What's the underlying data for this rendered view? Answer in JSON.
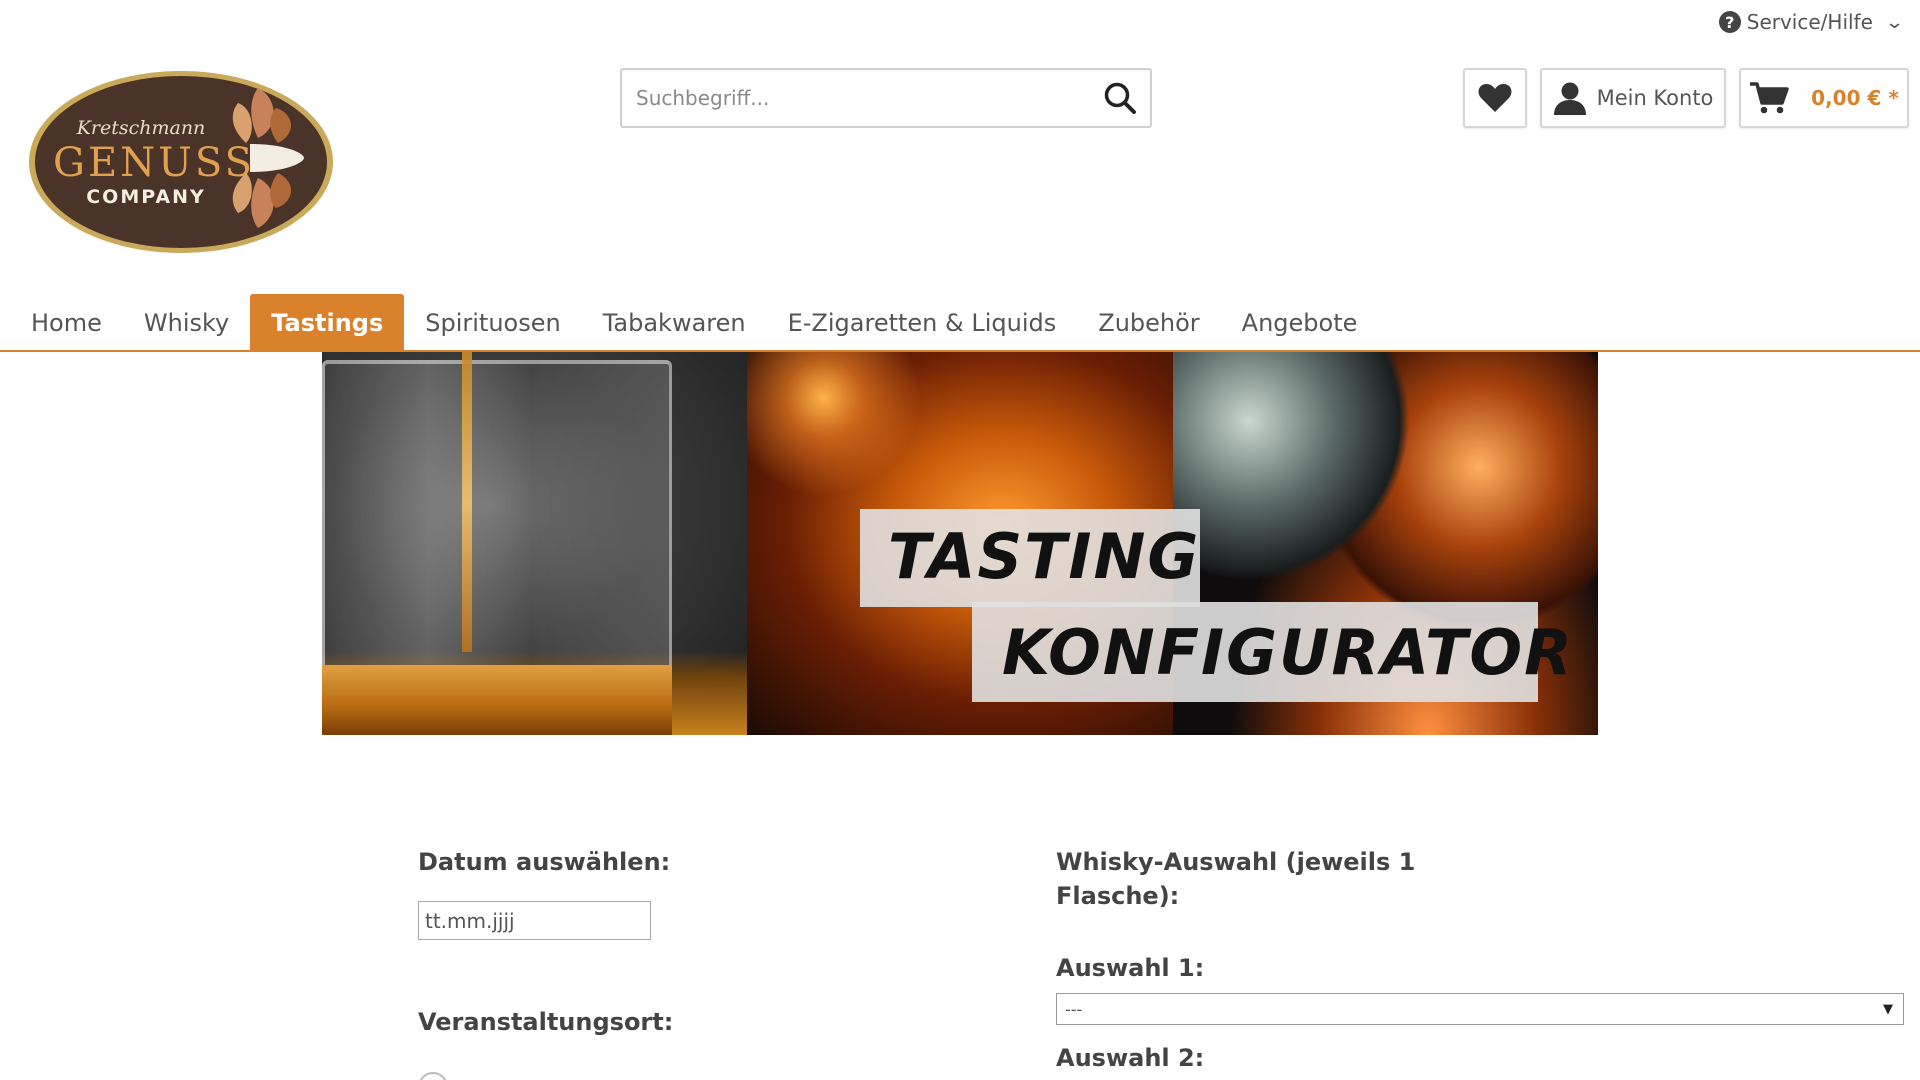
{
  "header": {
    "service_label": "Service/Hilfe",
    "search_placeholder": "Suchbegriff...",
    "account_label": "Mein Konto",
    "cart_amount": "0,00 € *",
    "logo": {
      "script": "Kretschmann",
      "word": "GENUSS",
      "sub": "COMPANY"
    }
  },
  "nav": {
    "items": [
      "Home",
      "Whisky",
      "Tastings",
      "Spirituosen",
      "Tabakwaren",
      "E-Zigaretten & Liquids",
      "Zubehör",
      "Angebote"
    ],
    "active": "Tastings"
  },
  "banner": {
    "line1": "TASTING",
    "line2": "KONFIGURATOR"
  },
  "form": {
    "date_label": "Datum auswählen:",
    "date_placeholder": "tt.mm.jjjj",
    "venue_label": "Veranstaltungsort:",
    "whisky_label_line1": "Whisky-Auswahl (jeweils 1",
    "whisky_label_line2": "Flasche):",
    "choice1_label": "Auswahl 1:",
    "choice1_value": "---",
    "choice2_label": "Auswahl 2:"
  },
  "colors": {
    "accent": "#d9822b",
    "logo_brown": "#4a3328",
    "logo_gold": "#c9a95a"
  }
}
